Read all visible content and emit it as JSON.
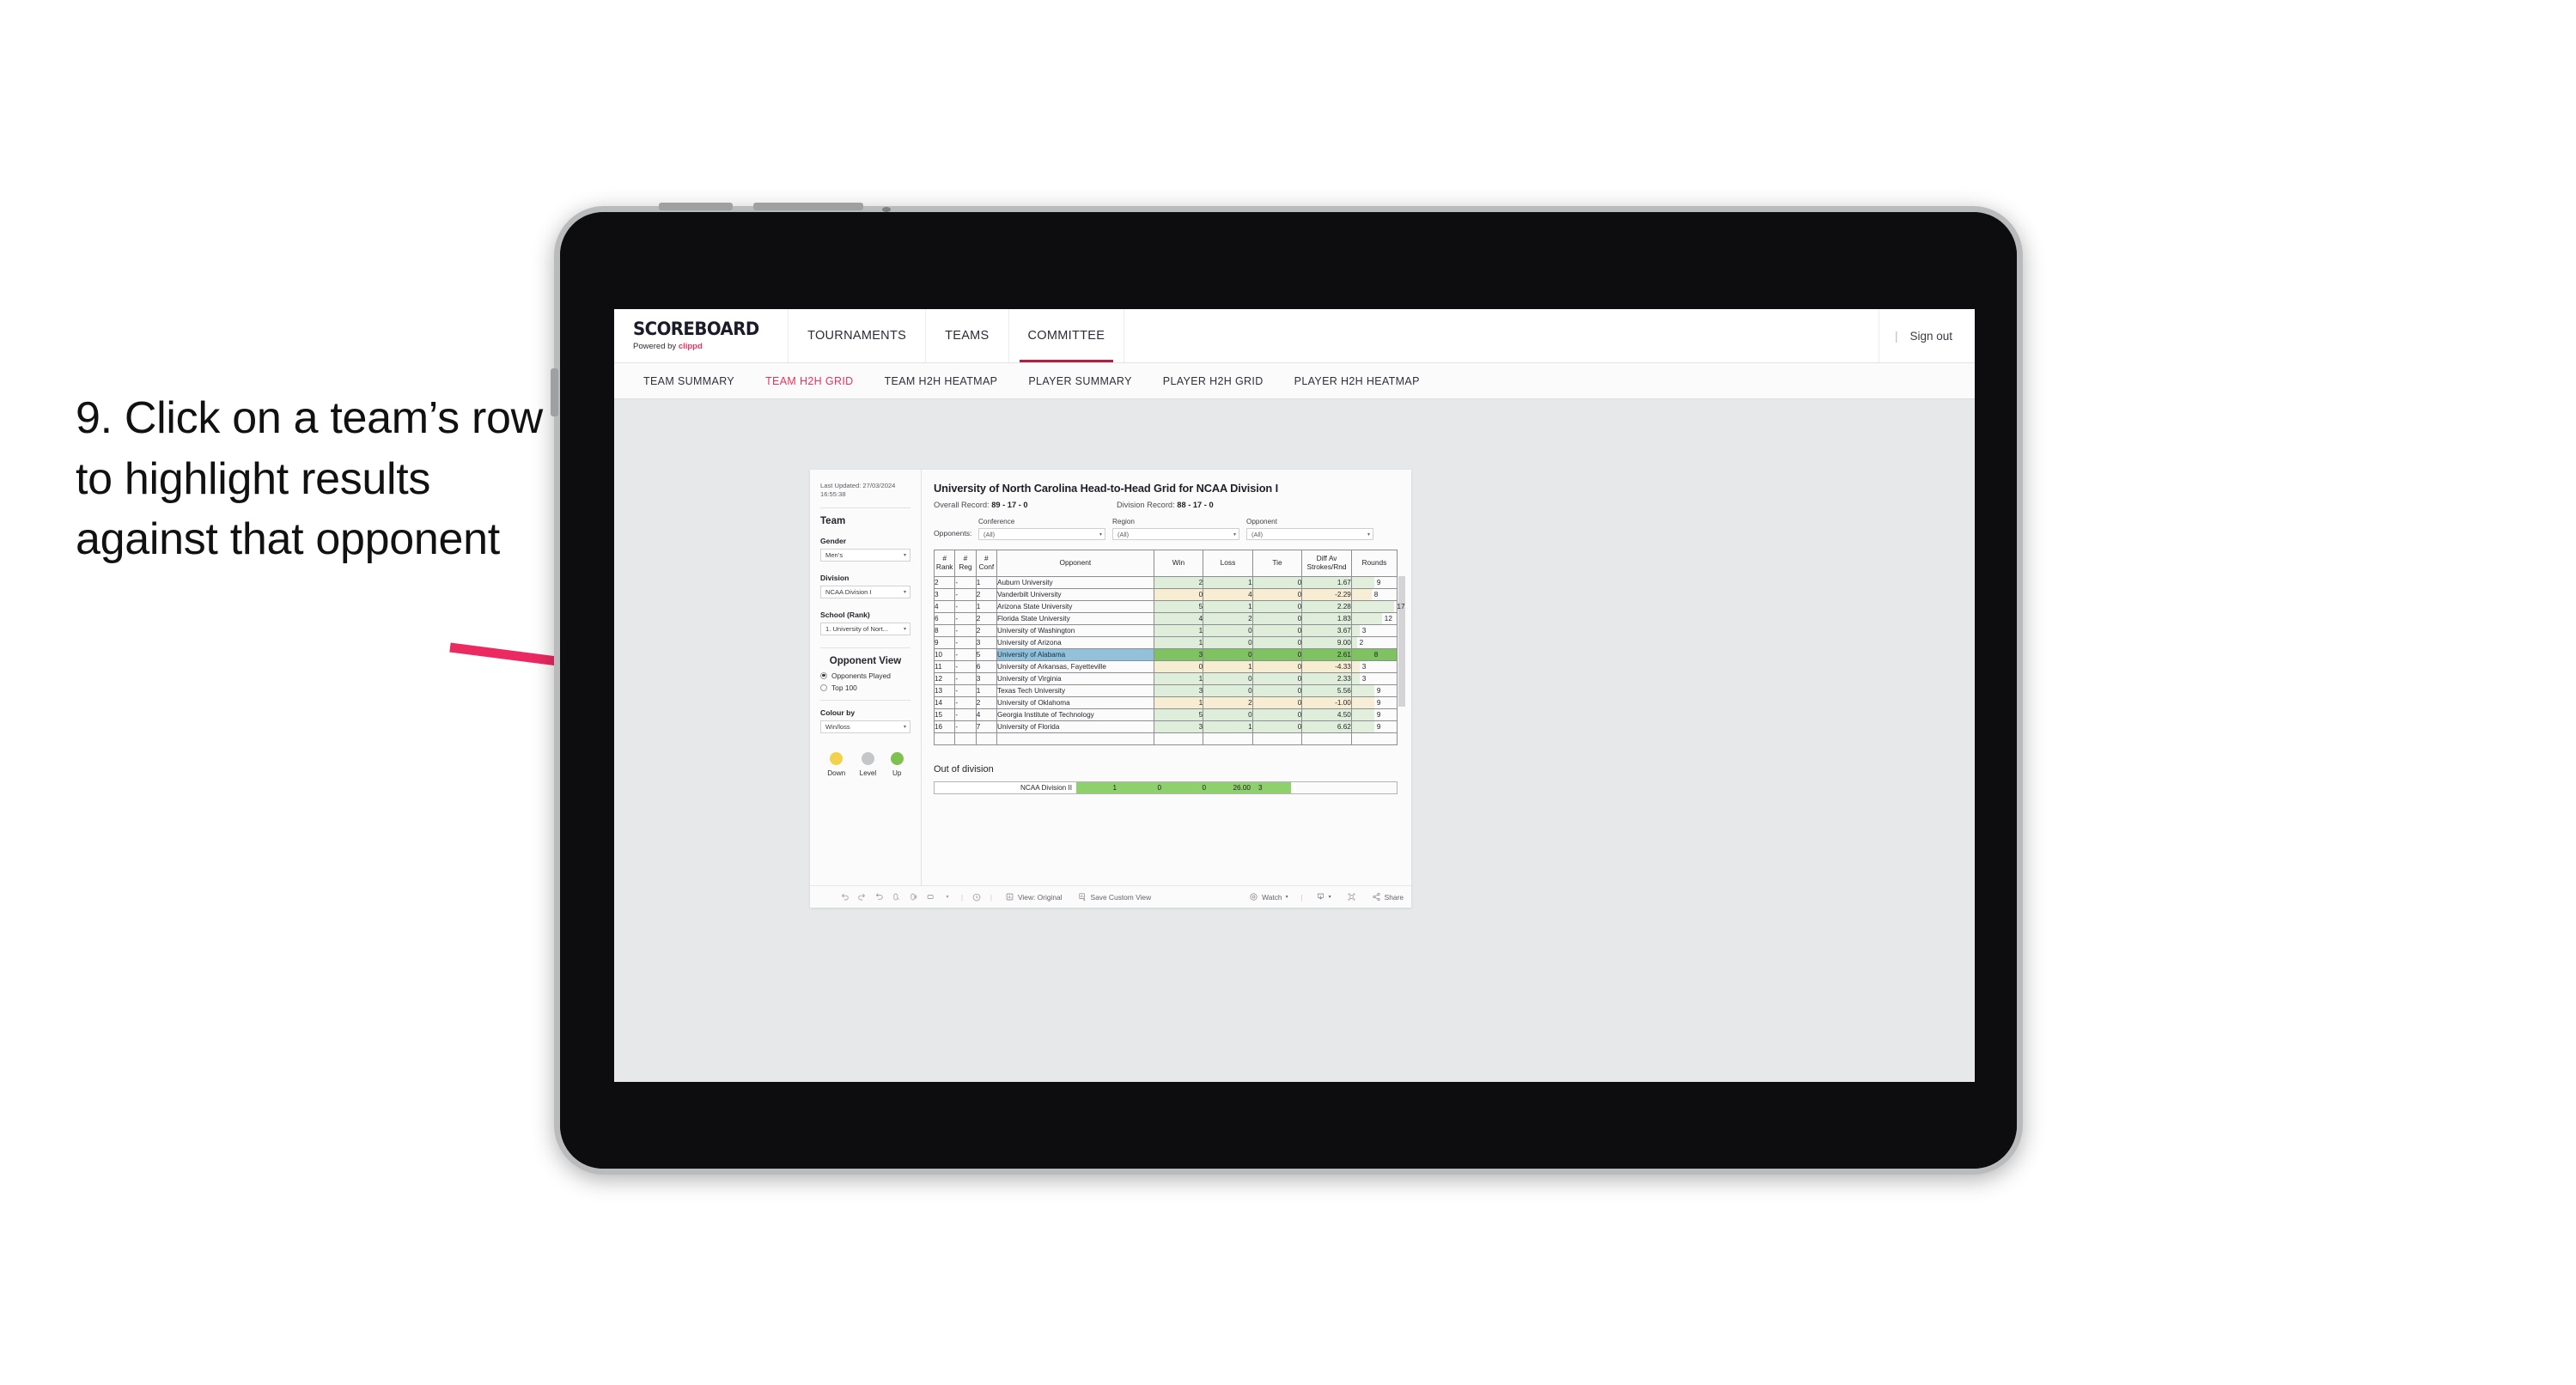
{
  "annotation": {
    "text": "9. Click on a team’s row to highlight results against that opponent"
  },
  "app": {
    "brand": {
      "name": "SCOREBOARD",
      "powered_prefix": "Powered by ",
      "powered_by": "clippd"
    },
    "topnav": {
      "items": [
        {
          "label": "TOURNAMENTS",
          "active": false
        },
        {
          "label": "TEAMS",
          "active": false
        },
        {
          "label": "COMMITTEE",
          "active": true
        }
      ],
      "separator": "|",
      "sign_out": "Sign out"
    },
    "subnav": {
      "items": [
        {
          "label": "TEAM SUMMARY",
          "active": false
        },
        {
          "label": "TEAM H2H GRID",
          "active": true
        },
        {
          "label": "TEAM H2H HEATMAP",
          "active": false
        },
        {
          "label": "PLAYER SUMMARY",
          "active": false
        },
        {
          "label": "PLAYER H2H GRID",
          "active": false
        },
        {
          "label": "PLAYER H2H HEATMAP",
          "active": false
        }
      ]
    },
    "sidebar": {
      "last_updated": "Last Updated: 27/03/2024 16:55:38",
      "team_heading": "Team",
      "gender_label": "Gender",
      "gender_value": "Men’s",
      "division_label": "Division",
      "division_value": "NCAA Division I",
      "school_label": "School (Rank)",
      "school_value": "1. University of Nort...",
      "opponent_view_heading": "Opponent View",
      "opponent_view_options": [
        {
          "label": "Opponents Played",
          "selected": true
        },
        {
          "label": "Top 100",
          "selected": false
        }
      ],
      "colour_by_label": "Colour by",
      "colour_by_value": "Win/loss",
      "legend": [
        {
          "label": "Down",
          "color": "#f2d14b"
        },
        {
          "label": "Level",
          "color": "#c4c6c8"
        },
        {
          "label": "Up",
          "color": "#7fc14f"
        }
      ]
    },
    "main": {
      "title": "University of North Carolina Head-to-Head Grid for NCAA Division I",
      "overall_record_label": "Overall Record:",
      "overall_record_value": "89 - 17 - 0",
      "division_record_label": "Division Record:",
      "division_record_value": "88 - 17 - 0",
      "opponents_label": "Opponents:",
      "filters": [
        {
          "label": "Conference",
          "value": "(All)"
        },
        {
          "label": "Region",
          "value": "(All)"
        },
        {
          "label": "Opponent",
          "value": "(All)"
        }
      ],
      "out_of_division_title": "Out of division",
      "out_of_division_row": {
        "label": "NCAA Division II",
        "win": "1",
        "loss": "0",
        "tie": "0",
        "diff": "26.00",
        "rounds": "3",
        "rounds_pct": 88
      }
    },
    "toolbar": {
      "view_label": "View: Original",
      "save_label": "Save Custom View",
      "watch_label": "Watch",
      "share_label": "Share",
      "caret": "▾",
      "separator": "|"
    }
  },
  "chart_data": {
    "type": "table",
    "title": "University of North Carolina Head-to-Head Grid for NCAA Division I",
    "columns": [
      "# Rank",
      "# Reg",
      "# Conf",
      "Opponent",
      "Win",
      "Loss",
      "Tie",
      "Diff Av Strokes/Rnd",
      "Rounds"
    ],
    "rows": [
      {
        "rank": "2",
        "reg": "-",
        "conf": "1",
        "opponent": "Auburn University",
        "win": "2",
        "loss": "1",
        "tie": "0",
        "diff": "1.67",
        "rounds": "9",
        "rounds_pct": 50,
        "tone": "up",
        "selected": false
      },
      {
        "rank": "3",
        "reg": "-",
        "conf": "2",
        "opponent": "Vanderbilt University",
        "win": "0",
        "loss": "4",
        "tie": "0",
        "diff": "-2.29",
        "rounds": "8",
        "rounds_pct": 44,
        "tone": "down",
        "selected": false
      },
      {
        "rank": "4",
        "reg": "-",
        "conf": "1",
        "opponent": "Arizona State University",
        "win": "5",
        "loss": "1",
        "tie": "0",
        "diff": "2.28",
        "rounds": "17",
        "rounds_pct": 95,
        "tone": "up",
        "selected": false
      },
      {
        "rank": "6",
        "reg": "-",
        "conf": "2",
        "opponent": "Florida State University",
        "win": "4",
        "loss": "2",
        "tie": "0",
        "diff": "1.83",
        "rounds": "12",
        "rounds_pct": 67,
        "tone": "up",
        "selected": false
      },
      {
        "rank": "8",
        "reg": "-",
        "conf": "2",
        "opponent": "University of Washington",
        "win": "1",
        "loss": "0",
        "tie": "0",
        "diff": "3.67",
        "rounds": "3",
        "rounds_pct": 17,
        "tone": "up",
        "selected": false
      },
      {
        "rank": "9",
        "reg": "-",
        "conf": "3",
        "opponent": "University of Arizona",
        "win": "1",
        "loss": "0",
        "tie": "0",
        "diff": "9.00",
        "rounds": "2",
        "rounds_pct": 11,
        "tone": "up",
        "selected": false
      },
      {
        "rank": "10",
        "reg": "-",
        "conf": "5",
        "opponent": "University of Alabama",
        "win": "3",
        "loss": "0",
        "tie": "0",
        "diff": "2.61",
        "rounds": "8",
        "rounds_pct": 44,
        "tone": "up",
        "selected": true
      },
      {
        "rank": "11",
        "reg": "-",
        "conf": "6",
        "opponent": "University of Arkansas, Fayetteville",
        "win": "0",
        "loss": "1",
        "tie": "0",
        "diff": "-4.33",
        "rounds": "3",
        "rounds_pct": 17,
        "tone": "down",
        "selected": false
      },
      {
        "rank": "12",
        "reg": "-",
        "conf": "3",
        "opponent": "University of Virginia",
        "win": "1",
        "loss": "0",
        "tie": "0",
        "diff": "2.33",
        "rounds": "3",
        "rounds_pct": 17,
        "tone": "up",
        "selected": false
      },
      {
        "rank": "13",
        "reg": "-",
        "conf": "1",
        "opponent": "Texas Tech University",
        "win": "3",
        "loss": "0",
        "tie": "0",
        "diff": "5.56",
        "rounds": "9",
        "rounds_pct": 50,
        "tone": "up",
        "selected": false
      },
      {
        "rank": "14",
        "reg": "-",
        "conf": "2",
        "opponent": "University of Oklahoma",
        "win": "1",
        "loss": "2",
        "tie": "0",
        "diff": "-1.00",
        "rounds": "9",
        "rounds_pct": 50,
        "tone": "down",
        "selected": false
      },
      {
        "rank": "15",
        "reg": "-",
        "conf": "4",
        "opponent": "Georgia Institute of Technology",
        "win": "5",
        "loss": "0",
        "tie": "0",
        "diff": "4.50",
        "rounds": "9",
        "rounds_pct": 50,
        "tone": "up",
        "selected": false
      },
      {
        "rank": "16",
        "reg": "-",
        "conf": "7",
        "opponent": "University of Florida",
        "win": "3",
        "loss": "1",
        "tie": "0",
        "diff": "6.62",
        "rounds": "9",
        "rounds_pct": 50,
        "tone": "up",
        "selected": false
      }
    ],
    "colors": {
      "up": "#dfeeda",
      "down": "#f7edd3",
      "selected_row": "#93c0db",
      "selected_cells": "#7fc261",
      "rounds_bar_up": "#e2efdd",
      "rounds_bar_down": "#f6eed6"
    }
  }
}
